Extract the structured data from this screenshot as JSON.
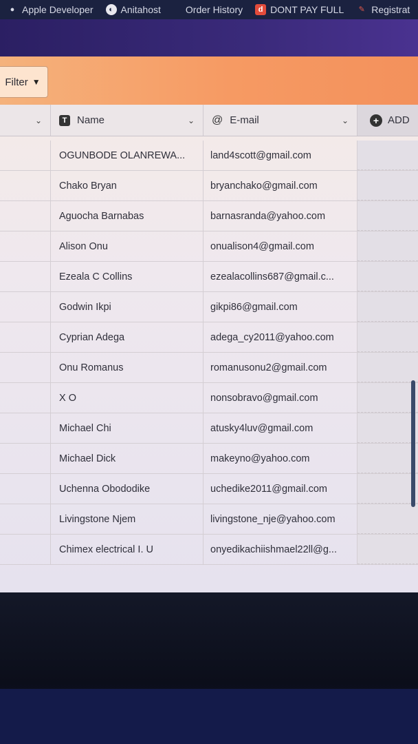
{
  "bookmarks": [
    {
      "icon": "apple-icon",
      "label": "Apple Developer"
    },
    {
      "icon": "anitahost-icon",
      "label": "Anitahost"
    },
    {
      "icon": "",
      "label": "Order History"
    },
    {
      "icon": "dontpay-icon",
      "label": "DONT PAY FULL"
    },
    {
      "icon": "registration-icon",
      "label": "Registrat"
    }
  ],
  "toolbar": {
    "filter_label": "Filter"
  },
  "columns": {
    "name": {
      "type_glyph": "T",
      "label": "Name"
    },
    "email": {
      "type_glyph": "@",
      "label": "E-mail"
    },
    "add": {
      "label": "ADD"
    }
  },
  "rows": [
    {
      "name": "OGUNBODE OLANREWA...",
      "email": "land4scott@gmail.com"
    },
    {
      "name": "Chako Bryan",
      "email": "bryanchako@gmail.com"
    },
    {
      "name": "Aguocha Barnabas",
      "email": "barnasranda@yahoo.com"
    },
    {
      "name": "Alison Onu",
      "email": "onualison4@gmail.com"
    },
    {
      "name": "Ezeala C Collins",
      "email": "ezealacollins687@gmail.c..."
    },
    {
      "name": "Godwin Ikpi",
      "email": "gikpi86@gmail.com"
    },
    {
      "name": "Cyprian Adega",
      "email": "adega_cy2011@yahoo.com"
    },
    {
      "name": "Onu Romanus",
      "email": "romanusonu2@gmail.com"
    },
    {
      "name": "X O",
      "email": "nonsobravo@gmail.com"
    },
    {
      "name": "Michael Chi",
      "email": "atusky4luv@gmail.com"
    },
    {
      "name": "Michael Dick",
      "email": "makeyno@yahoo.com"
    },
    {
      "name": "Uchenna Obododike",
      "email": "uchedike2011@gmail.com"
    },
    {
      "name": "Livingstone Njem",
      "email": "livingstone_nje@yahoo.com"
    },
    {
      "name": "Chimex electrical I. U",
      "email": "onyedikachiishmael22ll@g..."
    }
  ]
}
